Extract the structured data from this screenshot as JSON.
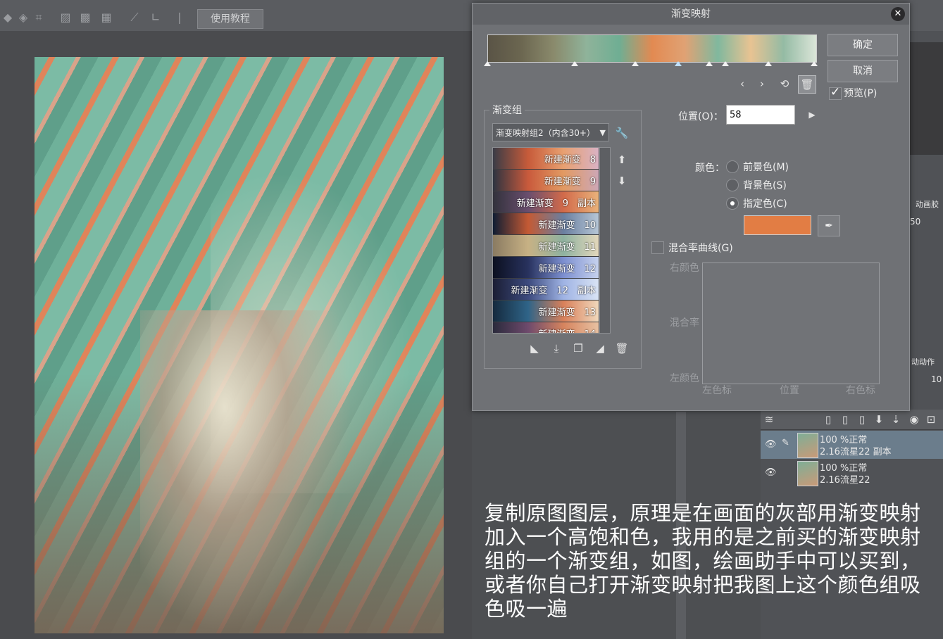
{
  "toolbar": {
    "tutorial_label": "使用教程",
    "icons": [
      "eraser-icon",
      "transform-icon",
      "hatch-icon",
      "fill-icon",
      "grid-icon",
      "ruler-icon",
      "ruler2-icon",
      "pen-icon"
    ]
  },
  "dialog": {
    "title": "渐变映射",
    "ok_label": "确定",
    "cancel_label": "取消",
    "preview_label": "预览(P)",
    "gradient_colors": [
      "#5a5446",
      "#6b6650",
      "#8a8a6c",
      "#8fb39a",
      "#6fae93",
      "#e28a52",
      "#e0a274",
      "#80b89e",
      "#e8c392",
      "#94bba4",
      "#dbe5d8"
    ],
    "gradient_group": {
      "legend": "渐变组",
      "selected_set": "渐变映射组2（内含30+）",
      "items": [
        {
          "label": "新建渐变　8",
          "colors": [
            "#3a3c46",
            "#c75b3a",
            "#e8a070",
            "#d9b2c4"
          ]
        },
        {
          "label": "新建渐变　9",
          "colors": [
            "#2d3340",
            "#c95a3c",
            "#e29a62",
            "#cda7b6"
          ]
        },
        {
          "label": "新建渐变　9　副本",
          "colors": [
            "#32323c",
            "#6a4e6e",
            "#d26a4a",
            "#e9b27a"
          ]
        },
        {
          "label": "新建渐变　10",
          "colors": [
            "#0f1d33",
            "#c45a34",
            "#6a7fa0",
            "#b6c6d6"
          ]
        },
        {
          "label": "新建渐变　11",
          "colors": [
            "#8a7b62",
            "#c7b184",
            "#8fb2a0",
            "#e3d7bb"
          ]
        },
        {
          "label": "新建渐变　12",
          "colors": [
            "#0c1020",
            "#28325e",
            "#7c8fd0",
            "#c6d2ee"
          ]
        },
        {
          "label": "新建渐变　12　副本",
          "colors": [
            "#1b1e34",
            "#3c4a7e",
            "#9fb3e4",
            "#d9e3f4"
          ]
        },
        {
          "label": "新建渐变　13",
          "colors": [
            "#152a3e",
            "#2f6488",
            "#d9805a",
            "#f0d8bc"
          ]
        },
        {
          "label": "新建渐变　14",
          "colors": [
            "#2a2a3c",
            "#6e4a6c",
            "#d6845e",
            "#e8c1a2"
          ]
        }
      ]
    },
    "position_label": "位置(O)：",
    "position_value": "58",
    "color_label": "颜色：",
    "fg_label": "前景色(M)",
    "bg_label": "背景色(S)",
    "specified_label": "指定色(C)",
    "specified_color": "#e27d44",
    "blend_curve_label": "混合率曲线(G)",
    "curve_right_color": "右颜色",
    "curve_blend": "混合率",
    "curve_left_color": "左颜色",
    "curve_left_marker": "左色标",
    "curve_position": "位置",
    "curve_right_marker": "右色标"
  },
  "layers": [
    {
      "opacity_mode": "100 %正常",
      "name": "2.16流星22 副本",
      "selected": true
    },
    {
      "opacity_mode": "100 %正常",
      "name": "2.16流星22",
      "selected": false
    }
  ],
  "right_panel": {
    "anim_label": "动画胶",
    "num_50": "50",
    "num_10": "10",
    "motion_label": "动动作"
  },
  "caption": "复制原图图层，原理是在画面的灰部用渐变映射加入一个高饱和色，我用的是之前买的渐变映射组的一个渐变组，如图，绘画助手中可以买到，或者你自己打开渐变映射把我图上这个颜色组吸色吸一遍"
}
